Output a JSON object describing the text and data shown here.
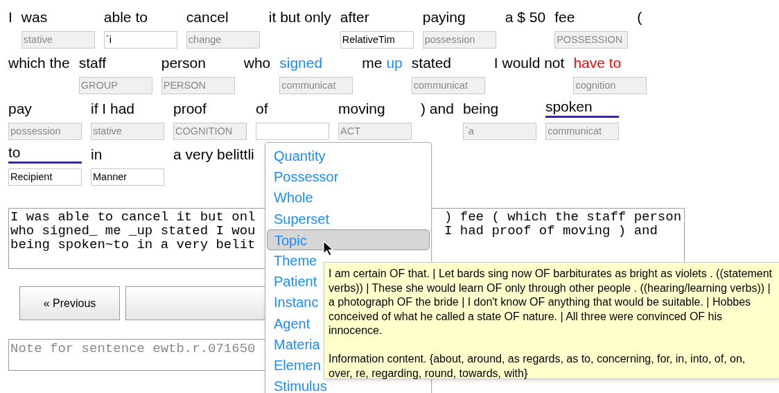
{
  "sentence_rows": [
    [
      {
        "words": [
          {
            "text": "I"
          }
        ]
      },
      {
        "words": [
          {
            "text": "was"
          }
        ],
        "field": {
          "value": "stative",
          "disabled": true
        }
      },
      {
        "words": [
          {
            "text": "able to"
          }
        ],
        "field": {
          "value": "`i",
          "disabled": false
        }
      },
      {
        "words": [
          {
            "text": "cancel"
          }
        ],
        "field": {
          "value": "change",
          "disabled": true
        }
      },
      {
        "words": [
          {
            "text": "it but only"
          }
        ]
      },
      {
        "words": [
          {
            "text": "after"
          }
        ],
        "field": {
          "value": "RelativeTim",
          "disabled": false
        }
      },
      {
        "words": [
          {
            "text": "paying"
          }
        ],
        "field": {
          "value": "possession",
          "disabled": true
        }
      },
      {
        "words": [
          {
            "text": "a $ 50"
          }
        ]
      },
      {
        "words": [
          {
            "text": "fee"
          }
        ],
        "field": {
          "value": "POSSESSION",
          "disabled": true
        }
      },
      {
        "words": [
          {
            "text": "("
          }
        ]
      }
    ],
    [
      {
        "words": [
          {
            "text": "which the"
          }
        ]
      },
      {
        "words": [
          {
            "text": "staff"
          }
        ],
        "field": {
          "value": "GROUP",
          "disabled": true
        }
      },
      {
        "words": [
          {
            "text": "person"
          }
        ],
        "field": {
          "value": "PERSON",
          "disabled": true
        }
      },
      {
        "words": [
          {
            "text": "who"
          }
        ]
      },
      {
        "words": [
          {
            "text": "signed",
            "color": "#1a8cff"
          }
        ],
        "field": {
          "value": "communicat",
          "disabled": true
        }
      },
      {
        "words": [
          {
            "text": "me"
          },
          {
            "text": "up",
            "color": "#1a8cff"
          }
        ]
      },
      {
        "words": [
          {
            "text": "stated"
          }
        ],
        "field": {
          "value": "communicat",
          "disabled": true
        }
      },
      {
        "words": [
          {
            "text": "I would not"
          }
        ]
      },
      {
        "words": [
          {
            "text": "have to",
            "color": "#ff0000"
          }
        ],
        "field": {
          "value": "cognition",
          "disabled": true
        }
      }
    ],
    [
      {
        "words": [
          {
            "text": "pay"
          }
        ],
        "field": {
          "value": "possession",
          "disabled": true
        }
      },
      {
        "words": [
          {
            "text": "if I had"
          }
        ],
        "field": {
          "value": "stative",
          "disabled": true
        }
      },
      {
        "words": [
          {
            "text": "proof"
          }
        ],
        "field": {
          "value": "COGNITION",
          "disabled": true
        }
      },
      {
        "words": [
          {
            "text": "of"
          }
        ],
        "field": {
          "disabled": false
        }
      },
      {
        "words": [
          {
            "text": "moving"
          }
        ],
        "field": {
          "value": "ACT",
          "disabled": true
        }
      },
      {
        "words": [
          {
            "text": ") and"
          }
        ]
      },
      {
        "words": [
          {
            "text": "being"
          }
        ],
        "field": {
          "value": "`a",
          "disabled": true
        }
      },
      {
        "words": [
          {
            "text": "spoken"
          }
        ],
        "underlined": true,
        "field": {
          "value": "communicat",
          "disabled": true
        }
      }
    ],
    [
      {
        "words": [
          {
            "text": "to"
          }
        ],
        "underlined": true,
        "field": {
          "value": "Recipient",
          "disabled": false
        }
      },
      {
        "words": [
          {
            "text": "in"
          }
        ],
        "field": {
          "value": "Manner",
          "disabled": false
        }
      },
      {
        "words": [
          {
            "text": "a very belittli"
          }
        ]
      }
    ]
  ],
  "source_text": [
    {
      "left": "I was able to cancel it but onl",
      "right": ") fee ( which the staff person"
    },
    {
      "left": "who signed_ me _up stated I wou",
      "right": "I had proof of moving ) and"
    },
    {
      "left": "being spoken~to in a very belit"
    }
  ],
  "buttons": [
    {
      "kind": "labeled",
      "label": "« Previous"
    },
    {
      "kind": "blank"
    }
  ],
  "note_field": {
    "placeholder": "Note for sentence ewtb.r.071650"
  },
  "dropdown": {
    "items": [
      {
        "label": "Quantity",
        "selected": false
      },
      {
        "label": "Possessor",
        "selected": false
      },
      {
        "label": "Whole",
        "selected": false
      },
      {
        "label": "Superset",
        "selected": false
      },
      {
        "label": "Topic",
        "selected": true
      },
      {
        "label": "Theme",
        "selected": false
      },
      {
        "label": "Patient",
        "selected": false
      },
      {
        "label": "Instanc",
        "selected": false
      },
      {
        "label": "Agent",
        "selected": false
      },
      {
        "label": "Materia",
        "selected": false
      },
      {
        "label": "Elemen",
        "selected": false
      },
      {
        "label": "Stimulus",
        "selected": false
      }
    ]
  },
  "tooltip": {
    "paragraphs": [
      "I am certain OF that. | Let bards sing now OF barbiturates as bright as violets . ((statement verbs)) | These she would learn OF only through other people . ((hearing/learning verbs)) | a photograph OF the bride | I don't know OF anything that would be suitable. | Hobbes conceived of what he called a state OF nature. | All three were convinced OF his innocence.",
      "Information content. {about, around, as regards, as to, concerning, for, in, into, of, on, over, re, regarding, round, towards, with}"
    ]
  }
}
